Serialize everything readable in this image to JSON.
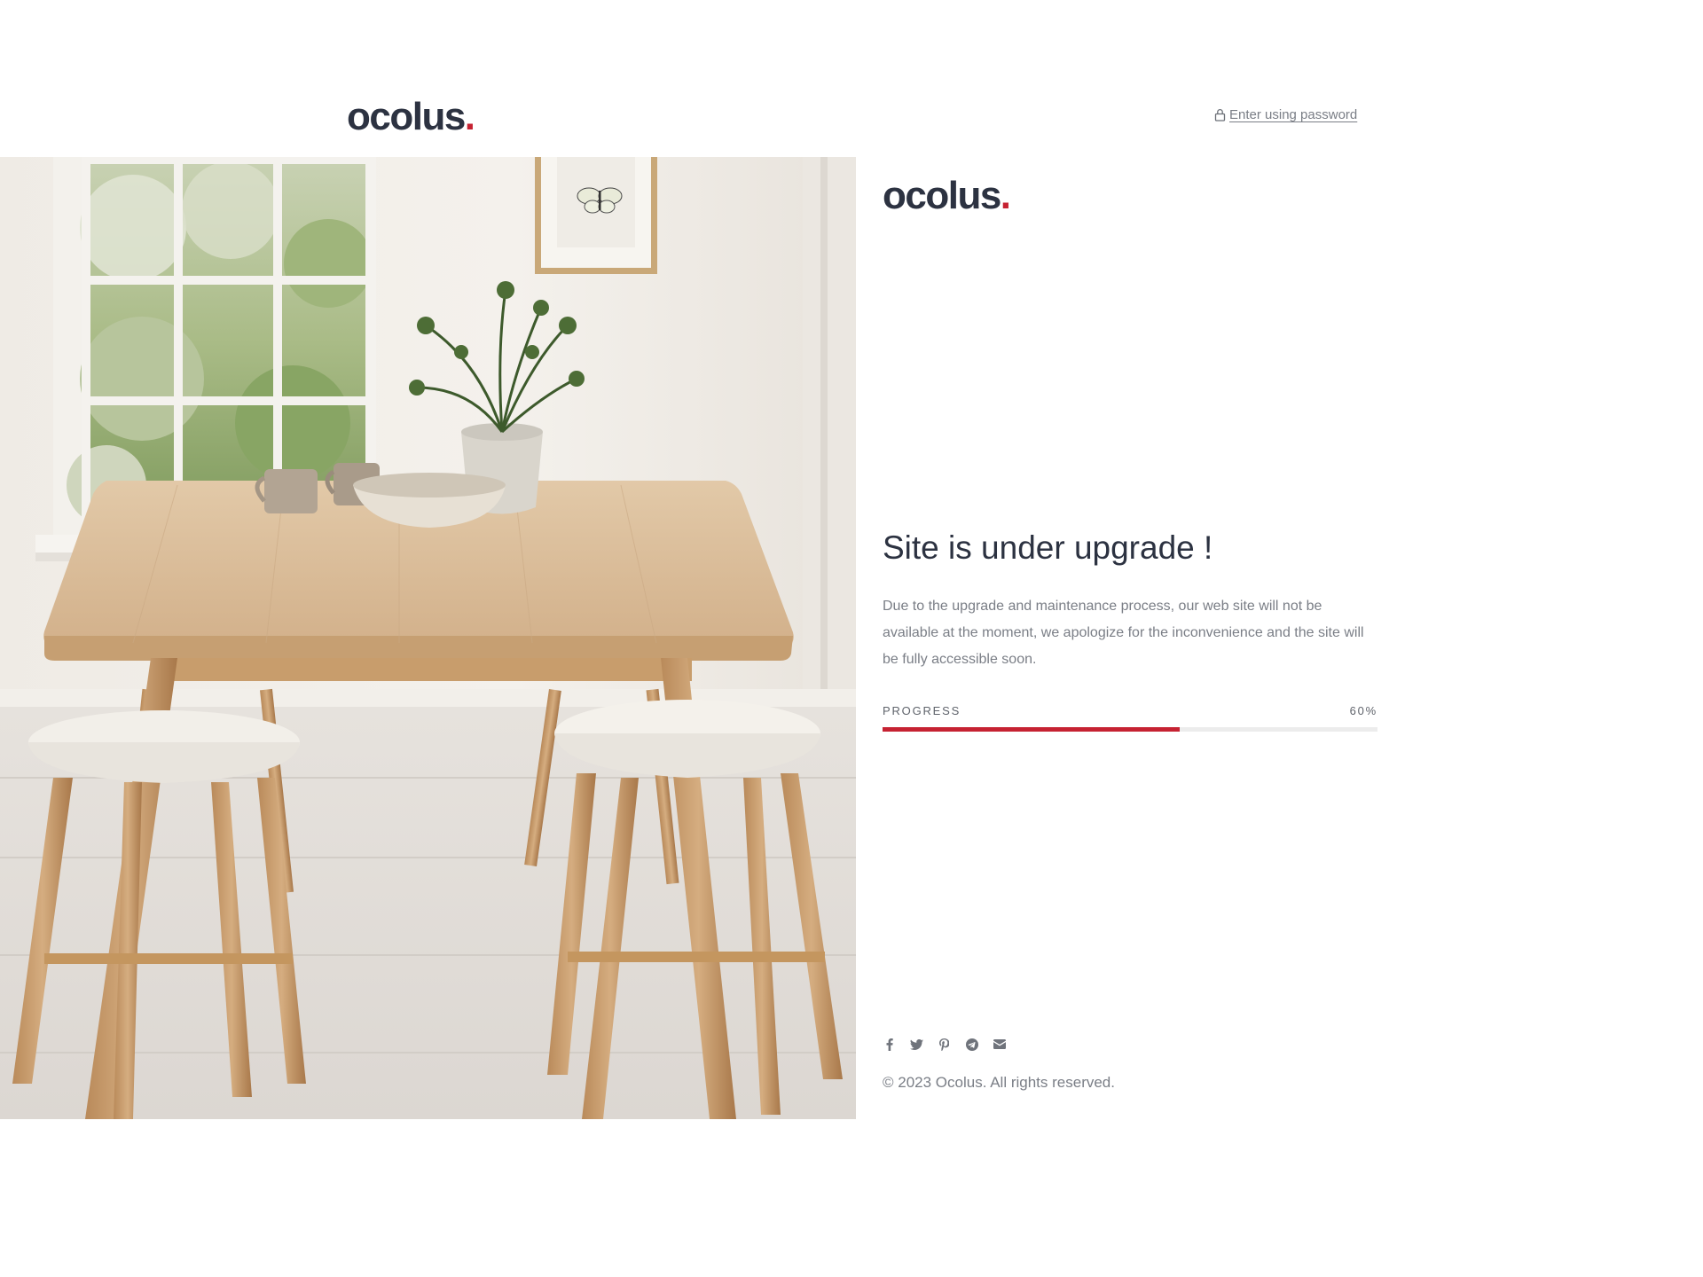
{
  "header": {
    "logo_text": "ocolus",
    "logo_dot": ".",
    "password_link": "Enter using password"
  },
  "panel": {
    "logo_text": "ocolus",
    "logo_dot": ".",
    "title": "Site is under upgrade !",
    "description": "Due to the upgrade and maintenance process, our web site will not be available at the moment, we apologize for the inconvenience and the site will be fully accessible soon.",
    "progress": {
      "label": "PROGRESS",
      "value_text": "60%",
      "value": 0.6
    },
    "socials": [
      "facebook-icon",
      "twitter-icon",
      "pinterest-icon",
      "telegram-icon",
      "email-icon"
    ],
    "copyright": "© 2023 Ocolus. All rights reserved."
  },
  "colors": {
    "brand_dark": "#2c3241",
    "accent_red": "#c62232",
    "muted_text": "#7a7e86",
    "track": "#ececec"
  }
}
